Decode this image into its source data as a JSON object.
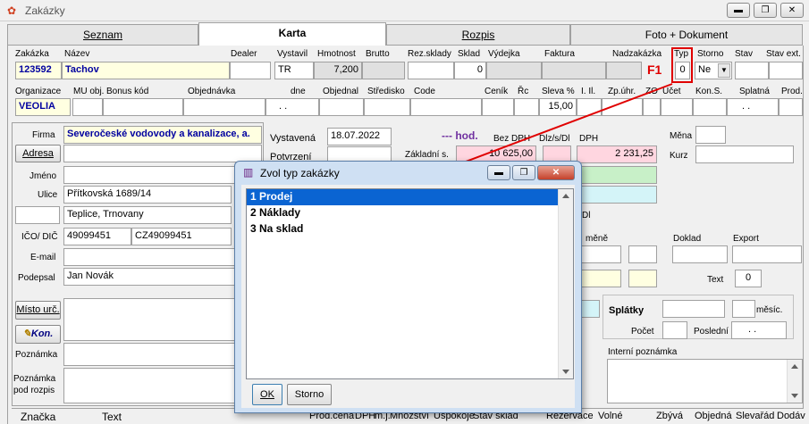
{
  "window": {
    "title": "Zakázky",
    "min": "▬",
    "max": "❐",
    "close": "✕"
  },
  "tabs": [
    {
      "label": "Seznam"
    },
    {
      "label": "Karta"
    },
    {
      "label": "Rozpis"
    },
    {
      "label": "Foto + Dokument"
    }
  ],
  "row1": {
    "labels": {
      "zakazka": "Zakázka",
      "nazev": "Název",
      "dealer": "Dealer",
      "vystavil": "Vystavil",
      "hmotnost": "Hmotnost",
      "brutto": "Brutto",
      "rezsklady": "Rez.sklady",
      "sklad": "Sklad",
      "vydejka": "Výdejka",
      "faktura": "Faktura",
      "nadzakazka": "Nadzakázka",
      "typ": "Typ",
      "storno": "Storno",
      "stav": "Stav",
      "stavext": "Stav ext."
    },
    "values": {
      "zakazka": "123592",
      "nazev": "Tachov",
      "vystavil": "TR",
      "hmotnost": "7,200",
      "sklad": "0",
      "f1": "F1",
      "typ": "0",
      "storno": "Ne"
    }
  },
  "row2": {
    "labels": {
      "organizace": "Organizace",
      "muobj": "MU obj.",
      "bonus": "Bonus kód",
      "objednavka": "Objednávka",
      "dne": "dne",
      "objednal": "Objednal",
      "stredisko": "Středisko",
      "code": "Code",
      "cenik": "Ceník",
      "rc": "Řc",
      "sleva": "Sleva %",
      "il": "I. Il.",
      "zpuhr": "Zp.úhr.",
      "zo": "ZO",
      "ucet": "Účet",
      "kons": "Kon.S.",
      "splatna": "Splatná",
      "prod": "Prod."
    },
    "values": {
      "organizace": "VEOLIA",
      "dne": ". .",
      "sleva": "15,00",
      "splatna": ". ."
    }
  },
  "left": {
    "firma_label": "Firma",
    "firma": "Severočeské vodovody a kanalizace, a.",
    "adresa_btn": "Adresa",
    "jmeno_label": "Jméno",
    "ulice_label": "Ulice",
    "ulice": "Přítkovská 1689/14",
    "mesto": "Teplice, Trnovany",
    "ico_label": "IČO/ DIČ",
    "ico": "49099451",
    "dic": "CZ49099451",
    "email_label": "E-mail",
    "podepsal_label": "Podepsal",
    "podepsal": "Jan Novák",
    "misto_btn": "Místo urč.",
    "kon_btn": "Kon.",
    "poznamka_label": "Poznámka",
    "poznamka_rozpis_label": "Poznámka pod rozpis"
  },
  "middle": {
    "vystavena_label": "Vystavená",
    "vystavena": "18.07.2022",
    "potvrzeni_label": "Potvrzení",
    "hod_label": "--- hod.",
    "bezdph_label": "Bez DPH",
    "dizsdi_label": "Dlz/s/Dl",
    "dph_label": "DPH",
    "zakladni_label": "Základní s.",
    "zakladni_bez": "10 625,00",
    "zakladni_dph": "2 231,25",
    "dl_label": "Dl"
  },
  "right": {
    "mena_label": "Měna",
    "kurz_label": "Kurz",
    "mene_label": "měně",
    "doklad_label": "Doklad",
    "export_label": "Export",
    "text_label": "Text",
    "text_value": "0",
    "splatky_label": "Splátky",
    "mesic_label": "měsíc.",
    "pocet_label": "Počet",
    "posledni_label": "Poslední",
    "posledni": ". .",
    "interni_label": "Interní poznámka"
  },
  "bottom": {
    "cols": [
      "Značka",
      "Text",
      "Prod.cena",
      "DPH",
      "m.j.",
      "Množství",
      "Uspokoje",
      "Stav sklad",
      "Rezervace",
      "Volné",
      "Zbývá",
      "Objedná",
      "Slevařád",
      "Dodáv"
    ]
  },
  "dialog": {
    "title": "Zvol typ zakázky",
    "items": [
      {
        "label": "1 Prodej"
      },
      {
        "label": "2 Náklady"
      },
      {
        "label": "3 Na sklad"
      }
    ],
    "ok": "OK",
    "storno": "Storno"
  },
  "colors": {
    "highlight": "#e00000",
    "selection": "#0a64d2",
    "blue_text": "#0000a0",
    "purple": "#7030a0"
  }
}
